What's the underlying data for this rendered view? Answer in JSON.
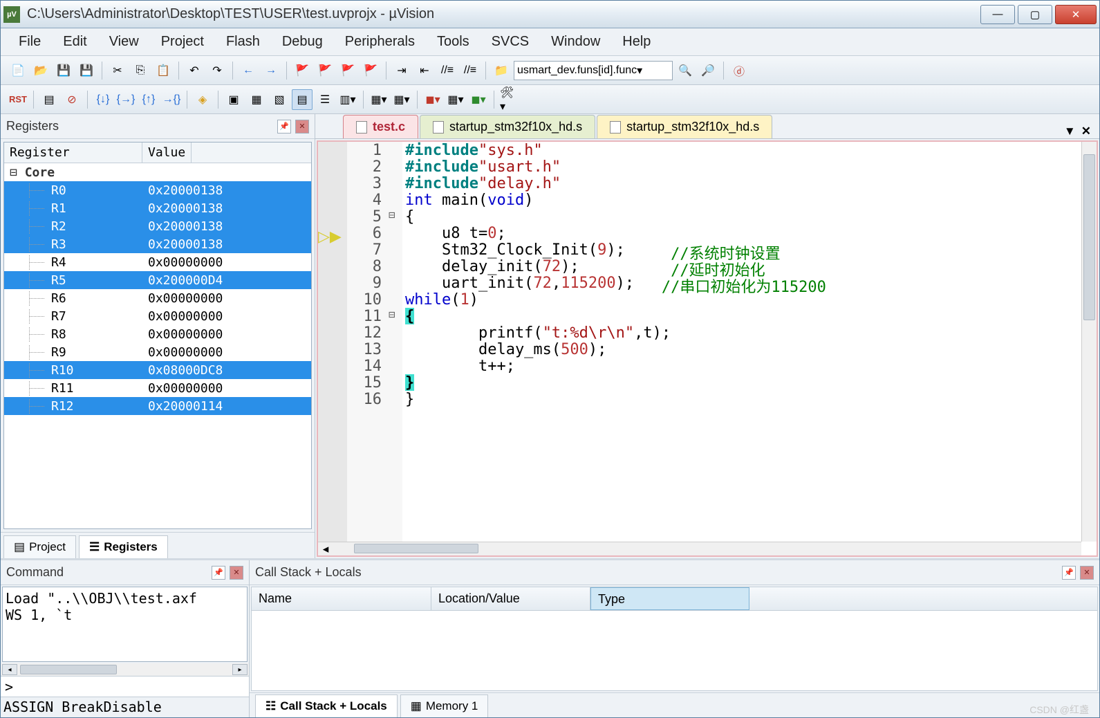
{
  "window": {
    "title": "C:\\Users\\Administrator\\Desktop\\TEST\\USER\\test.uvprojx - µVision",
    "icon_label": "µV"
  },
  "menus": [
    "File",
    "Edit",
    "View",
    "Project",
    "Flash",
    "Debug",
    "Peripherals",
    "Tools",
    "SVCS",
    "Window",
    "Help"
  ],
  "toolbar_combo": "usmart_dev.funs[id].func",
  "panes": {
    "registers": {
      "title": "Registers",
      "columns": [
        "Register",
        "Value"
      ],
      "group": "Core"
    },
    "command": {
      "title": "Command",
      "lines": [
        "Load \"..\\\\OBJ\\\\test.axf",
        "WS 1, `t"
      ],
      "prompt": ">",
      "status": "ASSIGN BreakDisable"
    },
    "locals": {
      "title": "Call Stack + Locals",
      "columns": [
        "Name",
        "Location/Value",
        "Type"
      ]
    }
  },
  "left_tabs": {
    "project": "Project",
    "registers": "Registers"
  },
  "locals_tabs": {
    "callstack": "Call Stack + Locals",
    "memory": "Memory 1"
  },
  "registers": [
    {
      "name": "R0",
      "value": "0x20000138",
      "sel": true
    },
    {
      "name": "R1",
      "value": "0x20000138",
      "sel": true
    },
    {
      "name": "R2",
      "value": "0x20000138",
      "sel": true
    },
    {
      "name": "R3",
      "value": "0x20000138",
      "sel": true
    },
    {
      "name": "R4",
      "value": "0x00000000",
      "sel": false
    },
    {
      "name": "R5",
      "value": "0x200000D4",
      "sel": true
    },
    {
      "name": "R6",
      "value": "0x00000000",
      "sel": false
    },
    {
      "name": "R7",
      "value": "0x00000000",
      "sel": false
    },
    {
      "name": "R8",
      "value": "0x00000000",
      "sel": false
    },
    {
      "name": "R9",
      "value": "0x00000000",
      "sel": false
    },
    {
      "name": "R10",
      "value": "0x08000DC8",
      "sel": true
    },
    {
      "name": "R11",
      "value": "0x00000000",
      "sel": false
    },
    {
      "name": "R12",
      "value": "0x20000114",
      "sel": true
    }
  ],
  "editor_tabs": [
    {
      "label": "test.c",
      "state": "active"
    },
    {
      "label": "startup_stm32f10x_hd.s",
      "state": "green"
    },
    {
      "label": "startup_stm32f10x_hd.s",
      "state": "yellow"
    }
  ],
  "code_lines_html": [
    "<span class='kw-teal'>#include</span> <span class='str'>\"sys.h\"</span>",
    "<span class='kw-teal'>#include</span> <span class='str'>\"usart.h\"</span>",
    "<span class='kw-teal'>#include</span> <span class='str'>\"delay.h\"</span>",
    "<span class='kw-blue'>int</span> main(<span class='kw-blue'>void</span>)",
    "{",
    "    u8 t=<span class='num'>0</span>;",
    "    Stm32_Clock_Init(<span class='num'>9</span>);     <span class='cmt'>//系统时钟设置</span>",
    "    delay_init(<span class='num'>72</span>);          <span class='cmt'>//延时初始化</span>",
    "    uart_init(<span class='num'>72</span>,<span class='num'>115200</span>);   <span class='cmt'>//串口初始化为115200</span>",
    "    <span class='kw-blue'>while</span>(<span class='num'>1</span>)",
    "    <span class='brace'>{</span>",
    "        printf(<span class='str'>\"t:%d\\r\\n\"</span>,t);",
    "        delay_ms(<span class='num'>500</span>);",
    "        t++;",
    "    <span class='brace'>}</span>",
    "}"
  ],
  "line_start": 1,
  "fold_marks": {
    "5": "⊟",
    "11": "⊟"
  },
  "watermark": "CSDN @红盏"
}
